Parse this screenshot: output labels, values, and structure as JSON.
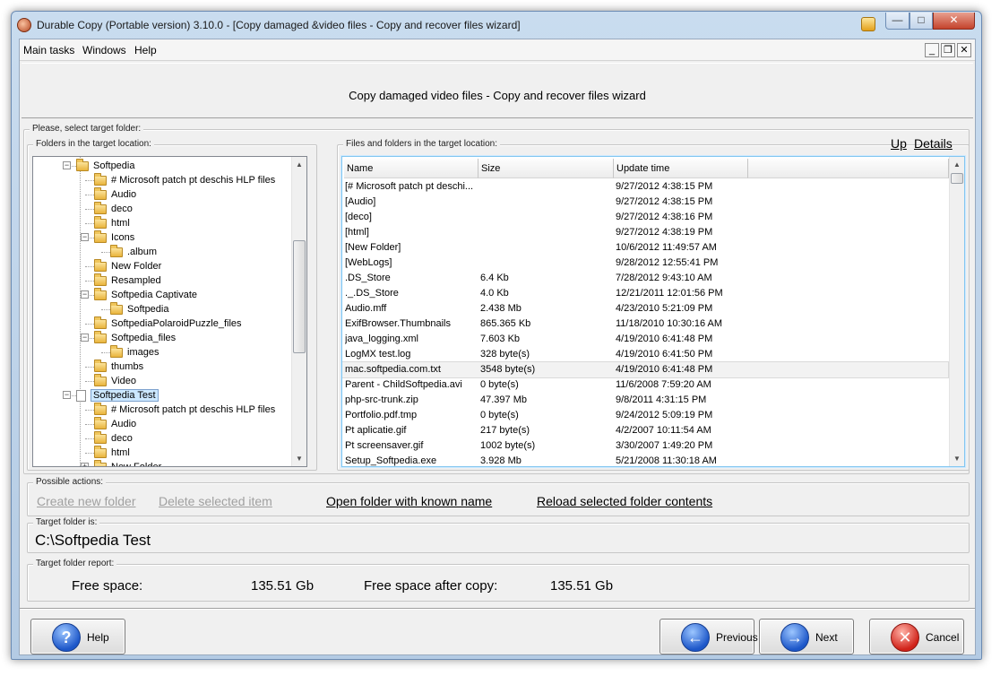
{
  "window": {
    "title": "Durable Copy (Portable version) 3.10.0 - [Copy damaged &video files - Copy and recover files wizard]"
  },
  "menu": {
    "items": [
      "Main tasks",
      "Windows",
      "Help"
    ],
    "mdi_buttons": [
      "_",
      "❐",
      "✕"
    ]
  },
  "wizard": {
    "title": "Copy damaged video files - Copy and recover files wizard"
  },
  "select_target": {
    "group_label": "Please, select target folder:",
    "tree_label": "Folders in the target location:",
    "files_label": "Files and folders in the target location:",
    "up_link": "Up",
    "details_link": "Details"
  },
  "tree": [
    {
      "label": "Softpedia",
      "type": "folder",
      "level": 1,
      "expander": "minus"
    },
    {
      "label": "# Microsoft patch pt deschis HLP files",
      "type": "folder",
      "level": 2
    },
    {
      "label": "Audio",
      "type": "folder",
      "level": 2
    },
    {
      "label": "deco",
      "type": "folder",
      "level": 2
    },
    {
      "label": "html",
      "type": "folder",
      "level": 2
    },
    {
      "label": "Icons",
      "type": "folder",
      "level": 2,
      "expander": "minus"
    },
    {
      "label": ".album",
      "type": "folder",
      "level": 3
    },
    {
      "label": "New Folder",
      "type": "folder",
      "level": 2
    },
    {
      "label": "Resampled",
      "type": "folder",
      "level": 2
    },
    {
      "label": "Softpedia Captivate",
      "type": "folder",
      "level": 2,
      "expander": "minus"
    },
    {
      "label": "Softpedia",
      "type": "folder",
      "level": 3
    },
    {
      "label": "SoftpediaPolaroidPuzzle_files",
      "type": "folder",
      "level": 2
    },
    {
      "label": "Softpedia_files",
      "type": "folder",
      "level": 2,
      "expander": "minus"
    },
    {
      "label": "images",
      "type": "folder",
      "level": 3
    },
    {
      "label": "thumbs",
      "type": "folder",
      "level": 2
    },
    {
      "label": "Video",
      "type": "folder",
      "level": 2
    },
    {
      "label": "Softpedia Test",
      "type": "file",
      "level": 1,
      "expander": "minus",
      "selected": true
    },
    {
      "label": "# Microsoft patch pt deschis HLP files",
      "type": "folder",
      "level": 2
    },
    {
      "label": "Audio",
      "type": "folder",
      "level": 2
    },
    {
      "label": "deco",
      "type": "folder",
      "level": 2
    },
    {
      "label": "html",
      "type": "folder",
      "level": 2
    },
    {
      "label": "New Folder",
      "type": "folder",
      "level": 2,
      "expander": "plus"
    }
  ],
  "file_columns": [
    "Name",
    "Size",
    "Update time"
  ],
  "files": [
    {
      "name": "[# Microsoft patch pt deschi...",
      "size": "",
      "time": "9/27/2012 4:38:15 PM"
    },
    {
      "name": "[Audio]",
      "size": "",
      "time": "9/27/2012 4:38:15 PM"
    },
    {
      "name": "[deco]",
      "size": "",
      "time": "9/27/2012 4:38:16 PM"
    },
    {
      "name": "[html]",
      "size": "",
      "time": "9/27/2012 4:38:19 PM"
    },
    {
      "name": "[New Folder]",
      "size": "",
      "time": "10/6/2012 11:49:57 AM"
    },
    {
      "name": "[WebLogs]",
      "size": "",
      "time": "9/28/2012 12:55:41 PM"
    },
    {
      "name": ".DS_Store",
      "size": "6.4 Kb",
      "time": "7/28/2012 9:43:10 AM"
    },
    {
      "name": "._.DS_Store",
      "size": "4.0 Kb",
      "time": "12/21/2011 12:01:56 PM"
    },
    {
      "name": "Audio.mff",
      "size": "2.438 Mb",
      "time": "4/23/2010 5:21:09 PM"
    },
    {
      "name": "ExifBrowser.Thumbnails",
      "size": "865.365 Kb",
      "time": "11/18/2010 10:30:16 AM"
    },
    {
      "name": "java_logging.xml",
      "size": "7.603 Kb",
      "time": "4/19/2010 6:41:48 PM"
    },
    {
      "name": "LogMX test.log",
      "size": "328 byte(s)",
      "time": "4/19/2010 6:41:50 PM"
    },
    {
      "name": "mac.softpedia.com.txt",
      "size": "3548 byte(s)",
      "time": "4/19/2010 6:41:48 PM",
      "highlight": true
    },
    {
      "name": "Parent - ChildSoftpedia.avi",
      "size": "0 byte(s)",
      "time": "11/6/2008 7:59:20 AM"
    },
    {
      "name": "php-src-trunk.zip",
      "size": "47.397 Mb",
      "time": "9/8/2011 4:31:15 PM"
    },
    {
      "name": "Portfolio.pdf.tmp",
      "size": "0 byte(s)",
      "time": "9/24/2012 5:09:19 PM"
    },
    {
      "name": "Pt aplicatie.gif",
      "size": "217 byte(s)",
      "time": "4/2/2007 10:11:54 AM"
    },
    {
      "name": "Pt screensaver.gif",
      "size": "1002 byte(s)",
      "time": "3/30/2007 1:49:20 PM"
    },
    {
      "name": "Setup_Softpedia.exe",
      "size": "3.928 Mb",
      "time": "5/21/2008 11:30:18 AM"
    }
  ],
  "actions": {
    "group_label": "Possible actions:",
    "create_folder": "Create new folder",
    "delete_item": "Delete selected item",
    "open_folder": "Open folder with known name",
    "reload": "Reload selected folder contents"
  },
  "target": {
    "group_label": "Target folder is:",
    "path": "C:\\Softpedia Test"
  },
  "report": {
    "group_label": "Target folder report:",
    "free_space_label": "Free space:",
    "free_space_value": "135.51 Gb",
    "free_after_label": "Free space after copy:",
    "free_after_value": "135.51 Gb"
  },
  "buttons": {
    "help": "Help",
    "previous": "Previous",
    "next": "Next",
    "cancel": "Cancel"
  },
  "icons": {
    "help": "?",
    "previous": "←",
    "next": "→",
    "cancel": "✕"
  }
}
